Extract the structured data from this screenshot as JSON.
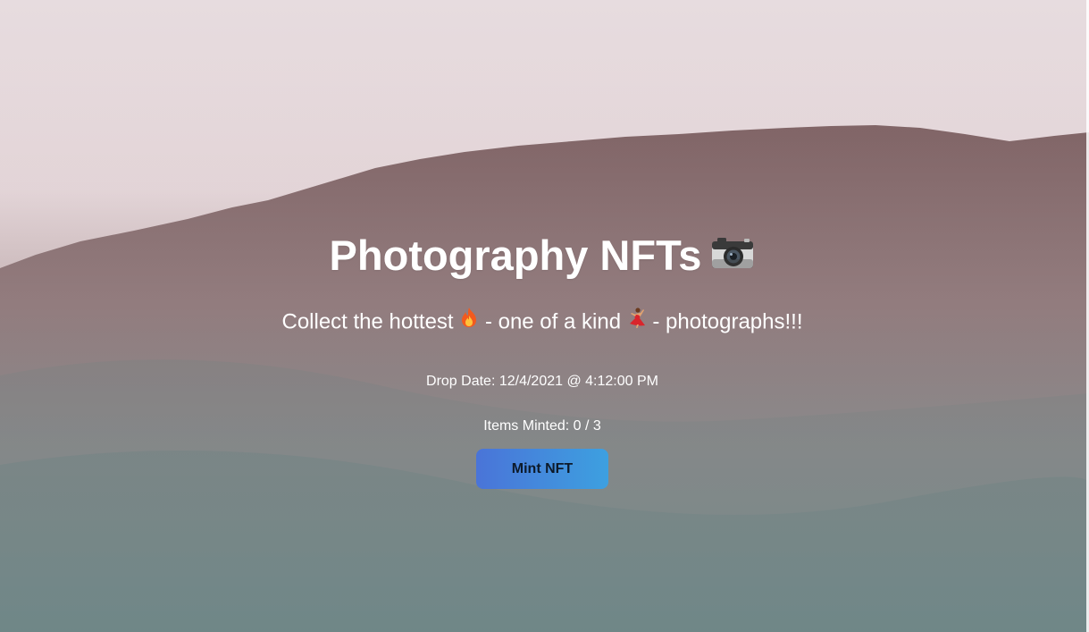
{
  "hero": {
    "title": "Photography NFTs",
    "title_icon": "camera-icon",
    "subtitle_parts": [
      "Collect the hottest",
      "- one of a kind",
      "- photographs!!!"
    ],
    "subtitle_icons": [
      "fire-icon",
      "dancer-icon"
    ]
  },
  "drop": {
    "date_text": "Drop Date: 12/4/2021 @ 4:12:00 PM"
  },
  "mint": {
    "items_minted_text": "Items Minted: 0 / 3",
    "items_minted": 0,
    "items_total": 3,
    "button_label": "Mint NFT"
  },
  "colors": {
    "button_gradient_start": "#4a74d8",
    "button_gradient_end": "#3da0e0",
    "text": "#ffffff"
  }
}
